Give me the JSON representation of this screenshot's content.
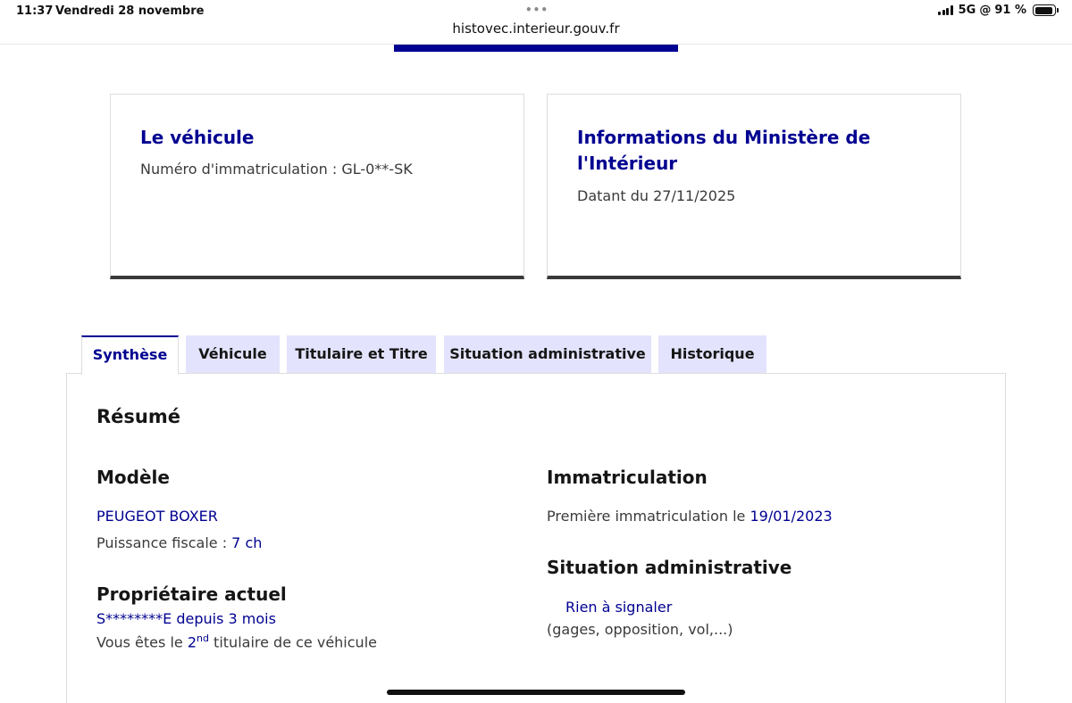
{
  "statusbar": {
    "time": "11:37",
    "date": "Vendredi 28 novembre",
    "dots": "•••",
    "url": "histovec.interieur.gouv.fr",
    "network": "5G",
    "battery": "91 %"
  },
  "cards": {
    "vehicle": {
      "title": "Le véhicule",
      "plate_label": "Numéro d'immatriculation : GL-0**-SK"
    },
    "ministry": {
      "title": "Informations du Ministère de l'Intérieur",
      "date_label": "Datant du 27/11/2025"
    }
  },
  "tabs": [
    {
      "label": "Synthèse",
      "active": true
    },
    {
      "label": "Véhicule",
      "active": false
    },
    {
      "label": "Titulaire et Titre",
      "active": false
    },
    {
      "label": "Situation administrative",
      "active": false
    },
    {
      "label": "Historique",
      "active": false
    }
  ],
  "summary": {
    "heading": "Résumé",
    "model": {
      "heading": "Modèle",
      "name": "PEUGEOT BOXER",
      "power_label": "Puissance fiscale : ",
      "power_value": "7 ch"
    },
    "owner": {
      "heading": "Propriétaire actuel",
      "name": "S********E",
      "since_label": " depuis ",
      "since_value": "3 mois",
      "rank_prefix": "Vous êtes le ",
      "rank_value": "2",
      "rank_sup": "nd",
      "rank_suffix": " titulaire de ce véhicule"
    },
    "registration": {
      "heading": "Immatriculation",
      "first_label": "Première immatriculation le ",
      "first_value": "19/01/2023"
    },
    "admin": {
      "heading": "Situation administrative",
      "status": "Rien à signaler",
      "note": "(gages, opposition, vol,...)"
    }
  },
  "colors": {
    "primary": "#000091",
    "tab_bg": "#e3e3fd",
    "text": "#3a3a3a"
  }
}
